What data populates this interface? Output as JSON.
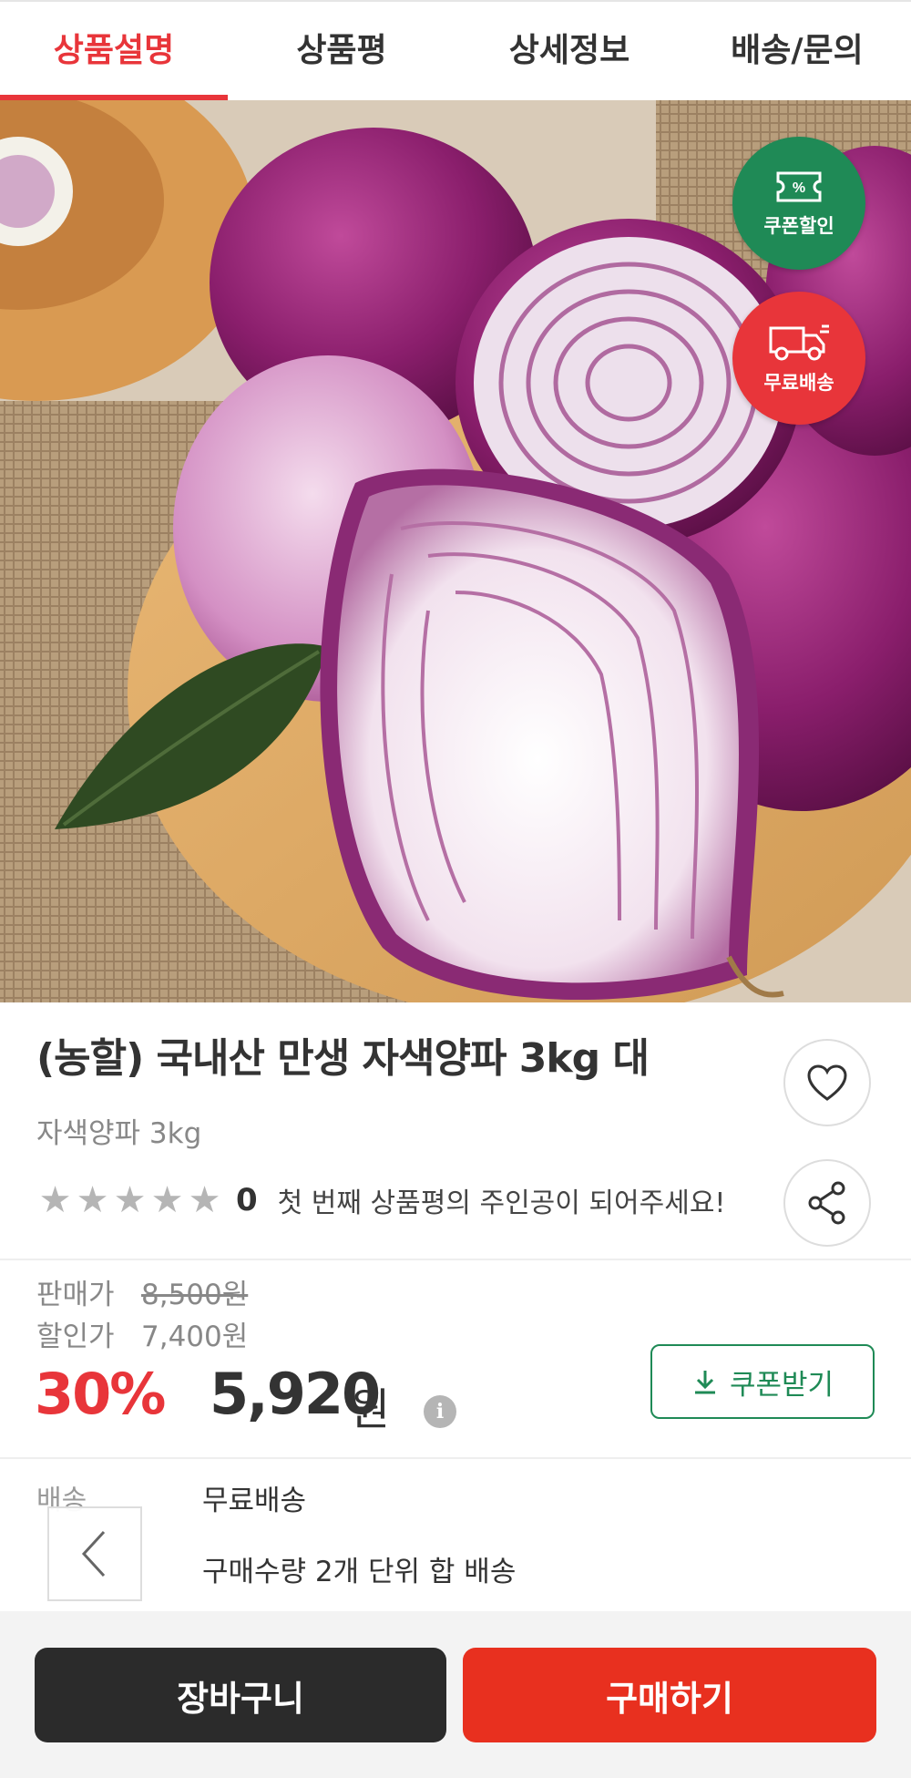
{
  "tabs": [
    {
      "label": "상품설명",
      "active": true
    },
    {
      "label": "상품평",
      "active": false
    },
    {
      "label": "상세정보",
      "active": false
    },
    {
      "label": "배송/문의",
      "active": false
    }
  ],
  "badges": {
    "coupon": {
      "label": "쿠폰할인",
      "symbol": "%",
      "color": "#1f8a56",
      "icon": "coupon-icon"
    },
    "shipping": {
      "label": "무료배송",
      "color": "#e8353a",
      "icon": "truck-icon"
    }
  },
  "product": {
    "title": "(농할) 국내산 만생 자색양파 3kg 대",
    "subtitle": "자색양파 3kg",
    "rating_stars": 0,
    "rating_max": 5,
    "review_count": "0",
    "review_prompt": "첫 번째 상품평의 주인공이 되어주세요!"
  },
  "price": {
    "sale_label": "판매가",
    "sale_value": "8,500원",
    "discount_label": "할인가",
    "discount_value": "7,400원",
    "discount_rate": "30%",
    "final_price": "5,920",
    "currency": "원",
    "info_symbol": "i",
    "coupon_button": "쿠폰받기"
  },
  "shipping": {
    "label": "배송",
    "method": "무료배송",
    "note": "구매수량 2개 단위 합 배송"
  },
  "actions": {
    "cart": "장바구니",
    "buy": "구매하기"
  },
  "colors": {
    "accent_red": "#e8353a",
    "accent_green": "#1f8a56",
    "dark_button": "#2b2b2b"
  }
}
